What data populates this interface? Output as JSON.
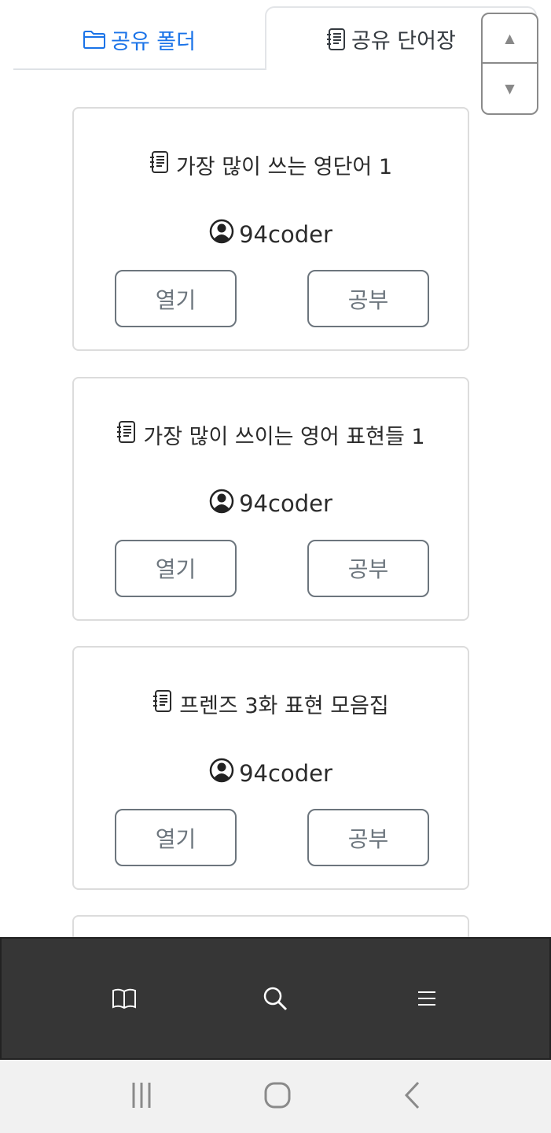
{
  "tabs": [
    {
      "label": "공유 폴더",
      "icon": "folder-icon",
      "active": false,
      "color": "#1a73e8"
    },
    {
      "label": "공유 단어장",
      "icon": "notebook-icon",
      "active": true
    }
  ],
  "scroll_controls": {
    "up": "▲",
    "down": "▼"
  },
  "cards": [
    {
      "title": "가장 많이 쓰는 영단어 1",
      "author": "94coder",
      "open_label": "열기",
      "study_label": "공부"
    },
    {
      "title": "가장 많이 쓰이는 영어 표현들 1",
      "author": "94coder",
      "open_label": "열기",
      "study_label": "공부"
    },
    {
      "title": "프렌즈 3화 표현 모음집",
      "author": "94coder",
      "open_label": "열기",
      "study_label": "공부"
    }
  ],
  "bottom_nav": [
    "book-icon",
    "search-icon",
    "menu-icon"
  ],
  "system_nav": [
    "recent-apps-icon",
    "home-icon",
    "back-icon"
  ]
}
